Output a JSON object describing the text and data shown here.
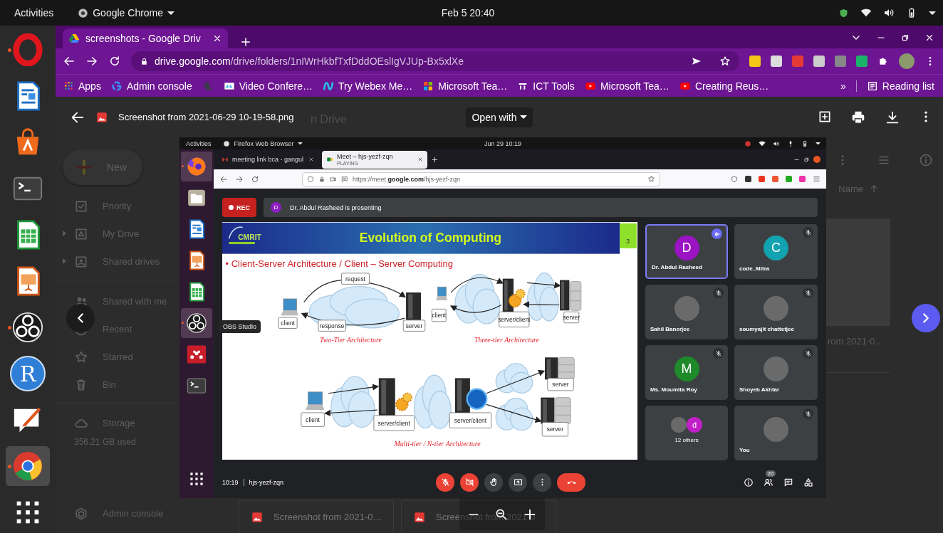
{
  "top_bar": {
    "activities": "Activities",
    "app_menu": "Google Chrome",
    "clock": "Feb 5  20:40"
  },
  "dock": [
    {
      "kind": "opera",
      "running": true,
      "selected": false
    },
    {
      "kind": "writer",
      "running": false,
      "selected": false
    },
    {
      "kind": "software",
      "running": false,
      "selected": false
    },
    {
      "kind": "terminal",
      "running": false,
      "selected": false
    },
    {
      "kind": "calc",
      "running": false,
      "selected": false
    },
    {
      "kind": "impress",
      "running": false,
      "selected": false
    },
    {
      "kind": "obs",
      "running": true,
      "selected": false
    },
    {
      "kind": "r",
      "label": "R",
      "running": false,
      "selected": false
    },
    {
      "kind": "drawing",
      "running": false,
      "selected": false
    },
    {
      "kind": "chrome",
      "running": true,
      "selected": true
    },
    {
      "kind": "apps",
      "running": false,
      "selected": false
    }
  ],
  "browser": {
    "tabs": [
      {
        "title": "screenshots - Google Driv",
        "selected": true
      }
    ],
    "url_host": "drive.google.com",
    "url_path": "/drive/folders/1nIWrHkbfTxfDddOEslIgVJUp-Bx5xlXe",
    "bookmarks": [
      {
        "kind": "apps",
        "label": "Apps"
      },
      {
        "kind": "google",
        "label": "Admin console"
      },
      {
        "kind": "moon"
      },
      {
        "kind": "cisco",
        "label": "Video Confere…"
      },
      {
        "kind": "webex",
        "label": "Try Webex Me…"
      },
      {
        "kind": "microsoft",
        "label": "Microsoft Tea…"
      },
      {
        "kind": "ict",
        "label": "ICT Tools"
      },
      {
        "kind": "youtube",
        "label": "Microsoft Tea…"
      },
      {
        "kind": "youtube",
        "label": "Creating Reus…"
      }
    ],
    "overflow": "»",
    "reading_list": "Reading list"
  },
  "drive": {
    "search_hint": "n Drive",
    "new": "New",
    "nav": [
      {
        "items": [
          {
            "kind": "priority",
            "label": "Priority",
            "expandable": false
          },
          {
            "kind": "drive",
            "label": "My Drive",
            "expandable": true
          },
          {
            "kind": "shared-drives",
            "label": "Shared drives",
            "expandable": true
          }
        ]
      },
      {
        "items": [
          {
            "kind": "people",
            "label": "Shared with me",
            "expandable": false
          },
          {
            "kind": "clock",
            "label": "Recent",
            "expandable": false
          },
          {
            "kind": "star",
            "label": "Starred",
            "expandable": false
          },
          {
            "kind": "bin",
            "label": "Bin",
            "expandable": false
          }
        ]
      }
    ],
    "storage": {
      "label": "Storage",
      "used": "356.21 GB used"
    },
    "admin": "Admin console",
    "sort_column": "Name",
    "grid_file": "rom 2021-0…",
    "list_files": [
      "Screenshot from 2021-0…",
      "Screenshot from 2021-0"
    ]
  },
  "viewer": {
    "file_name": "Screenshot from 2021-06-29 10-19-58.png",
    "open_with": "Open with"
  },
  "screenshot": {
    "top_bar": {
      "activities": "Activities",
      "app_menu": "Firefox Web Browser",
      "clock": "Jun 29  10:19"
    },
    "dock": [
      {
        "kind": "firefox",
        "running": true,
        "selected": true
      },
      {
        "kind": "files",
        "running": false,
        "selected": false
      },
      {
        "kind": "writer",
        "running": false,
        "selected": false
      },
      {
        "kind": "impress",
        "running": false,
        "selected": false
      },
      {
        "kind": "calc",
        "running": false,
        "selected": false
      },
      {
        "kind": "obs",
        "running": true,
        "selected": true
      },
      {
        "kind": "mendeley",
        "running": false,
        "selected": false
      },
      {
        "kind": "terminal",
        "running": false,
        "selected": false
      }
    ],
    "tooltip": "OBS Studio",
    "tabs": [
      {
        "title": "meeting link bca - gangul",
        "selected": false
      },
      {
        "title": "Meet – hjs-yezf-zqn",
        "status": "PLAYING",
        "selected": true
      }
    ],
    "url": "https://meet.**google.com**/hjs-yezf-zqn",
    "meet": {
      "recording": "REC",
      "presenter_initial": "D",
      "presenting": "Dr. Abdul Rasheed is presenting",
      "slide": {
        "logo": "CMRIT",
        "title": "Evolution of Computing",
        "page": "3",
        "bullet": "• Client-Server Architecture / Client – Server Computing",
        "diagrams": [
          {
            "caption": "Two-Tier Architecture",
            "labels": [
              "request",
              "client",
              "response",
              "server"
            ]
          },
          {
            "caption": "Three-tier Architecture",
            "labels": [
              "client",
              "server/client",
              "server"
            ]
          },
          {
            "caption": "Multi-tier / N-tier Architecture",
            "labels": [
              "client",
              "server/client",
              "server/client",
              "server",
              "server"
            ]
          }
        ]
      },
      "participants": [
        {
          "kind": "person",
          "name": "Dr. Abdul Rasheed",
          "avatars": [
            {
              "kind": "initial",
              "letter": "D",
              "color": "#9c13c4"
            }
          ],
          "muted": false,
          "speaking": true
        },
        {
          "kind": "person",
          "name": "code_Mitra",
          "avatars": [
            {
              "kind": "initial",
              "letter": "C",
              "color": "#12a2b0"
            }
          ],
          "muted": true,
          "speaking": false
        },
        {
          "kind": "person",
          "name": "Sahil Banerjee",
          "avatars": [
            {
              "kind": "photo"
            }
          ],
          "muted": true,
          "speaking": false
        },
        {
          "kind": "person",
          "name": "soumyajit chattetjee",
          "avatars": [
            {
              "kind": "photo"
            }
          ],
          "muted": true,
          "speaking": false
        },
        {
          "kind": "person",
          "name": "Ms. Moumita Roy",
          "avatars": [
            {
              "kind": "initial",
              "letter": "M",
              "color": "#1e8a2a"
            }
          ],
          "muted": true,
          "speaking": false
        },
        {
          "kind": "person",
          "name": "Shoyeb Akhtar",
          "avatars": [
            {
              "kind": "photo"
            }
          ],
          "muted": true,
          "speaking": false
        },
        {
          "kind": "others",
          "name": "12 others",
          "avatars": [
            {
              "kind": "photo"
            },
            {
              "kind": "initial",
              "letter": "d",
              "color": "#c21fc9"
            }
          ],
          "muted": false,
          "speaking": false
        },
        {
          "kind": "person",
          "name": "You",
          "avatars": [
            {
              "kind": "photo"
            }
          ],
          "muted": true,
          "speaking": false
        }
      ],
      "time": "10:19",
      "code": "hjs-yezf-zqn",
      "mic_on": false,
      "camera_on": false,
      "people_count": "20"
    }
  }
}
